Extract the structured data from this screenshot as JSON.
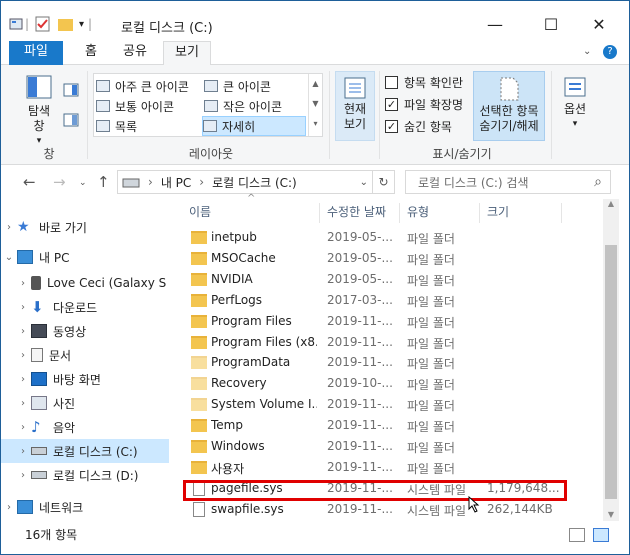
{
  "window": {
    "title": "로컬 디스크 (C:)",
    "controls": {
      "minimize": "—",
      "maximize": "☐",
      "close": "✕",
      "help": "?"
    }
  },
  "ribbon_tabs": [
    "파일",
    "홈",
    "공유",
    "보기"
  ],
  "ribbon": {
    "nav_pane_label": "탐색\n창",
    "layout_items": [
      "아주 큰 아이콘",
      "큰 아이콘",
      "보통 아이콘",
      "작은 아이콘",
      "목록",
      "자세히"
    ],
    "current_view_label": "현재\n보기",
    "checks": [
      {
        "label": "항목 확인란",
        "checked": false
      },
      {
        "label": "파일 확장명",
        "checked": true
      },
      {
        "label": "숨긴 항목",
        "checked": true
      }
    ],
    "hide_selected_label": "선택한 항목\n숨기기/해제",
    "options_label": "옵션",
    "group_labels": [
      "창",
      "레이아웃",
      "표시/숨기기"
    ]
  },
  "address": {
    "path": [
      "내 PC",
      "로컬 디스크 (C:)"
    ],
    "search_placeholder": "로컬 디스크 (C:) 검색"
  },
  "nav_pane": [
    {
      "label": "바로 가기",
      "icon": "star-icon",
      "indent": 1,
      "chev": ">"
    },
    {
      "label": "내 PC",
      "icon": "computer-icon",
      "indent": 1,
      "chev": "v"
    },
    {
      "label": "Love Ceci (Galaxy S",
      "icon": "phone-icon",
      "indent": 2,
      "chev": ">"
    },
    {
      "label": "다운로드",
      "icon": "download-icon",
      "indent": 2,
      "chev": ">"
    },
    {
      "label": "동영상",
      "icon": "video-icon",
      "indent": 2,
      "chev": ">"
    },
    {
      "label": "문서",
      "icon": "document-icon",
      "indent": 2,
      "chev": ">"
    },
    {
      "label": "바탕 화면",
      "icon": "desktop-icon",
      "indent": 2,
      "chev": ">"
    },
    {
      "label": "사진",
      "icon": "pictures-icon",
      "indent": 2,
      "chev": ">"
    },
    {
      "label": "음악",
      "icon": "music-icon",
      "indent": 2,
      "chev": ">"
    },
    {
      "label": "로컬 디스크 (C:)",
      "icon": "drive-icon",
      "indent": 2,
      "chev": ">",
      "selected": true
    },
    {
      "label": "로컬 디스크 (D:)",
      "icon": "drive-icon",
      "indent": 2,
      "chev": ">"
    },
    {
      "label": "네트워크",
      "icon": "network-icon",
      "indent": 1,
      "chev": ">"
    }
  ],
  "columns": [
    "이름",
    "수정한 날짜",
    "유형",
    "크기"
  ],
  "files": [
    {
      "name": "inetpub",
      "date": "2019-05-...",
      "type": "파일 폴더",
      "size": "",
      "kind": "folder"
    },
    {
      "name": "MSOCache",
      "date": "2019-05-...",
      "type": "파일 폴더",
      "size": "",
      "kind": "folder"
    },
    {
      "name": "NVIDIA",
      "date": "2019-05-...",
      "type": "파일 폴더",
      "size": "",
      "kind": "folder"
    },
    {
      "name": "PerfLogs",
      "date": "2017-03-...",
      "type": "파일 폴더",
      "size": "",
      "kind": "folder"
    },
    {
      "name": "Program Files",
      "date": "2019-11-...",
      "type": "파일 폴더",
      "size": "",
      "kind": "folder"
    },
    {
      "name": "Program Files (x8...",
      "date": "2019-11-...",
      "type": "파일 폴더",
      "size": "",
      "kind": "folder"
    },
    {
      "name": "ProgramData",
      "date": "2019-11-...",
      "type": "파일 폴더",
      "size": "",
      "kind": "folder-faded"
    },
    {
      "name": "Recovery",
      "date": "2019-10-...",
      "type": "파일 폴더",
      "size": "",
      "kind": "folder-faded"
    },
    {
      "name": "System Volume I...",
      "date": "2019-11-...",
      "type": "파일 폴더",
      "size": "",
      "kind": "folder-faded"
    },
    {
      "name": "Temp",
      "date": "2019-11-...",
      "type": "파일 폴더",
      "size": "",
      "kind": "folder"
    },
    {
      "name": "Windows",
      "date": "2019-11-...",
      "type": "파일 폴더",
      "size": "",
      "kind": "folder"
    },
    {
      "name": "사용자",
      "date": "2019-11-...",
      "type": "파일 폴더",
      "size": "",
      "kind": "folder"
    },
    {
      "name": "pagefile.sys",
      "date": "2019-11-...",
      "type": "시스템 파일",
      "size": "1,179,648...",
      "kind": "file"
    },
    {
      "name": "swapfile.sys",
      "date": "2019-11-...",
      "type": "시스템 파일",
      "size": "262,144KB",
      "kind": "file"
    }
  ],
  "status": {
    "count": "16개 항목"
  },
  "colors": {
    "accent": "#1979ca",
    "selection": "#cce8ff",
    "highlight": "#e00000"
  }
}
